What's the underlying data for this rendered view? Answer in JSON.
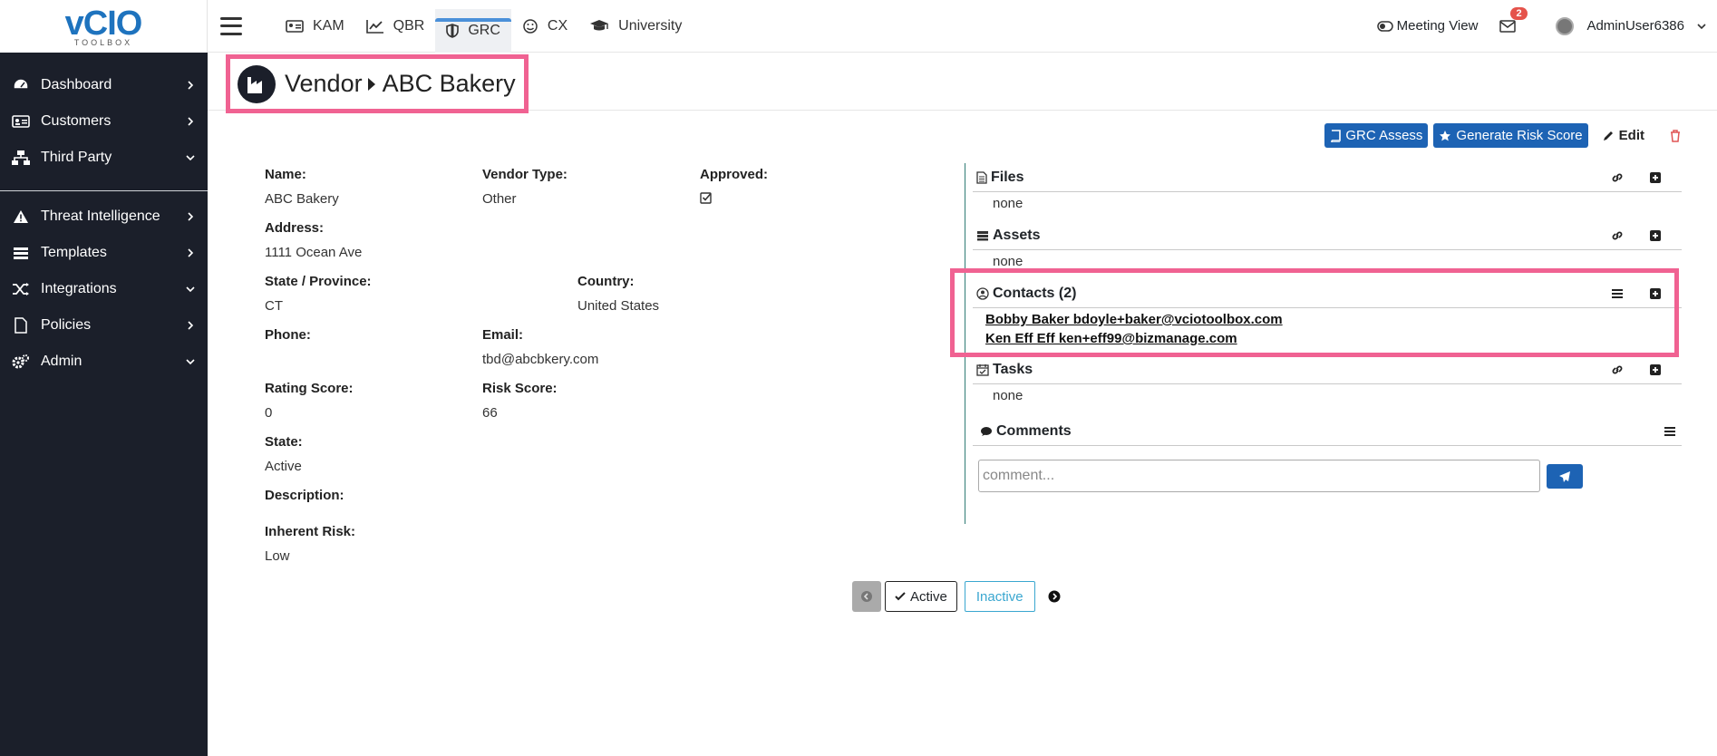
{
  "logo": {
    "text": "vCIO",
    "sub": "TOOLBOX"
  },
  "sidebar": {
    "items": [
      {
        "label": "Dashboard",
        "icon": "gauge-icon",
        "chevron": "right"
      },
      {
        "label": "Customers",
        "icon": "id-card-icon",
        "chevron": "right"
      },
      {
        "label": "Third Party",
        "icon": "network-icon",
        "chevron": "down"
      }
    ],
    "items2": [
      {
        "label": "Threat Intelligence",
        "icon": "warning-icon",
        "chevron": "right"
      },
      {
        "label": "Templates",
        "icon": "list-icon",
        "chevron": "right"
      },
      {
        "label": "Integrations",
        "icon": "shuffle-icon",
        "chevron": "down"
      },
      {
        "label": "Policies",
        "icon": "file-icon",
        "chevron": "right"
      },
      {
        "label": "Admin",
        "icon": "gears-icon",
        "chevron": "down"
      }
    ]
  },
  "topbar": {
    "tabs": [
      {
        "label": "KAM",
        "icon": "id-card-icon"
      },
      {
        "label": "QBR",
        "icon": "line-chart-icon"
      },
      {
        "label": "GRC",
        "icon": "shield-icon",
        "active": true
      },
      {
        "label": "CX",
        "icon": "smile-icon"
      },
      {
        "label": "University",
        "icon": "graduation-cap-icon"
      }
    ],
    "meeting_view": "Meeting View",
    "mail_count": "2",
    "username": "AdminUser6386"
  },
  "header": {
    "section": "Vendor",
    "title": "ABC Bakery"
  },
  "actions": {
    "grc_assess": "GRC Assess",
    "generate_risk_score": "Generate Risk Score",
    "edit": "Edit"
  },
  "vendor": {
    "name_label": "Name:",
    "name": "ABC Bakery",
    "type_label": "Vendor Type:",
    "type": "Other",
    "approved_label": "Approved:",
    "approved": true,
    "address_label": "Address:",
    "address": "1111 Ocean Ave",
    "state_prov_label": "State / Province:",
    "state_prov": "CT",
    "country_label": "Country:",
    "country": "United States",
    "phone_label": "Phone:",
    "phone": "",
    "email_label": "Email:",
    "email": "tbd@abcbkery.com",
    "rating_label": "Rating Score:",
    "rating": "0",
    "risk_label": "Risk Score:",
    "risk": "66",
    "state_label": "State:",
    "state": "Active",
    "description_label": "Description:",
    "description": "",
    "inherent_label": "Inherent Risk:",
    "inherent": "Low"
  },
  "panel": {
    "files": {
      "title": "Files",
      "body": "none"
    },
    "assets": {
      "title": "Assets",
      "body": "none"
    },
    "contacts": {
      "title": "Contacts (2)",
      "items": [
        "Bobby  Baker bdoyle+baker@vciotoolbox.com",
        "Ken Eff  Eff ken+eff99@bizmanage.com"
      ]
    },
    "tasks": {
      "title": "Tasks",
      "body": "none"
    },
    "comments": {
      "title": "Comments",
      "placeholder": "comment..."
    }
  },
  "pager": {
    "active": "Active",
    "inactive": "Inactive"
  },
  "colors": {
    "sidebar": "#1b1f2a",
    "accent": "#1d63b4",
    "highlight": "#f06292"
  }
}
